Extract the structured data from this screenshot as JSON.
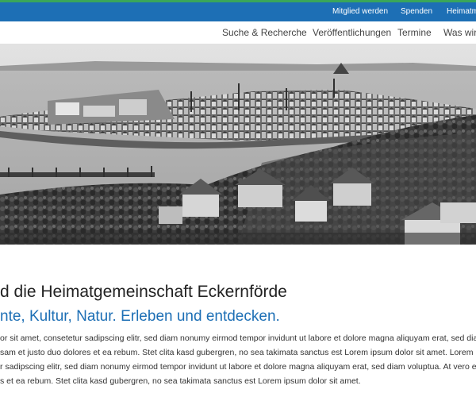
{
  "utility_nav": {
    "items": [
      {
        "label": "Mitglied werden"
      },
      {
        "label": "Spenden"
      },
      {
        "label": "Heimatm"
      }
    ]
  },
  "main_nav": {
    "items": [
      {
        "label": "Suche & Recherche"
      },
      {
        "label": "Veröffentlichungen"
      },
      {
        "label": "Termine"
      },
      {
        "label": "Was wir t"
      }
    ]
  },
  "colors": {
    "accent_blue": "#1d6fb5",
    "accent_green": "#3aa65a"
  },
  "content": {
    "heading": "d die Heimatgemeinschaft Eckernförde",
    "subheading": "nte, Kultur, Natur. Erleben und entdecken.",
    "body_lines": [
      "or sit amet, consetetur sadipscing elitr, sed diam nonumy eirmod tempor invidunt ut labore et dolore magna aliquyam erat, sed dia",
      "sam et justo duo dolores et ea rebum. Stet clita kasd gubergren, no sea takimata sanctus est Lorem ipsum dolor sit amet. Lorem i",
      "r sadipscing elitr, sed diam nonumy eirmod tempor invidunt ut labore et dolore magna aliquyam erat, sed diam voluptua. At vero eo",
      "s et ea rebum. Stet clita kasd gubergren, no sea takimata sanctus est Lorem ipsum dolor sit amet."
    ]
  }
}
